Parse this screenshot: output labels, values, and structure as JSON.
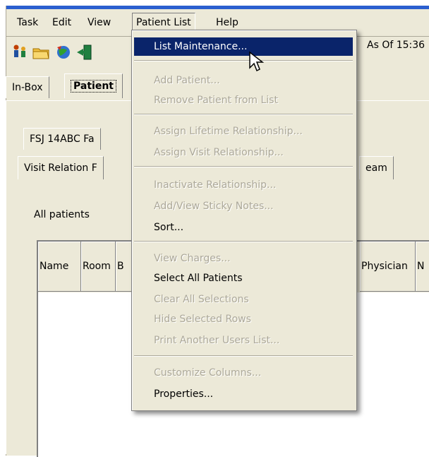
{
  "menubar": {
    "items": [
      {
        "label": "Task"
      },
      {
        "label": "Edit"
      },
      {
        "label": "View"
      },
      {
        "label": "Patient List"
      },
      {
        "label": "Help"
      }
    ]
  },
  "toolbar": {
    "icons": [
      "patient-icon",
      "open-folder-icon",
      "refresh-globe-icon",
      "exit-icon"
    ],
    "as_of": "As Of 15:36"
  },
  "tabs": {
    "inbox": "In-Box",
    "patient": "Patient"
  },
  "inner_tabs": {
    "row1_label": "FSJ 14ABC  Fa",
    "row2_visit": "Visit Relation F",
    "row2_team": "eam"
  },
  "list": {
    "title": "All patients",
    "columns": [
      {
        "label": "Name"
      },
      {
        "label": "Room"
      },
      {
        "label": "B"
      },
      {
        "label": "Physician"
      },
      {
        "label": "N"
      }
    ]
  },
  "dropdown": {
    "items": [
      {
        "label": "List Maintenance...",
        "enabled": true,
        "highlight": true
      },
      {
        "sep": true
      },
      {
        "label": "Add Patient...",
        "enabled": false
      },
      {
        "label": "Remove Patient from List",
        "enabled": false
      },
      {
        "sep": true
      },
      {
        "label": "Assign Lifetime Relationship...",
        "enabled": false
      },
      {
        "label": "Assign Visit Relationship...",
        "enabled": false
      },
      {
        "sep": true
      },
      {
        "label": "Inactivate Relationship...",
        "enabled": false
      },
      {
        "label": "Add/View Sticky Notes...",
        "enabled": false
      },
      {
        "label": "Sort...",
        "enabled": true
      },
      {
        "sep": true
      },
      {
        "label": "View Charges...",
        "enabled": false
      },
      {
        "label": "Select All Patients",
        "enabled": true
      },
      {
        "label": "Clear All Selections",
        "enabled": false
      },
      {
        "label": "Hide Selected Rows",
        "enabled": false
      },
      {
        "label": "Print Another Users List...",
        "enabled": false
      },
      {
        "sep": true
      },
      {
        "label": "Customize Columns...",
        "enabled": false
      },
      {
        "label": "Properties...",
        "enabled": true
      }
    ]
  },
  "colors": {
    "highlight": "#0a246a",
    "menu_bg": "#ece9d8",
    "disabled_text": "#aca899"
  }
}
